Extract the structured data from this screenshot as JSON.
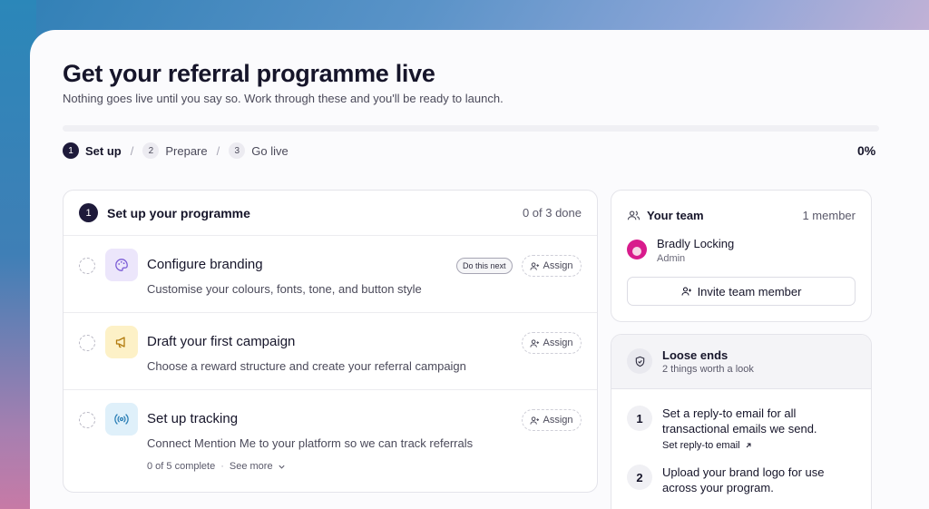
{
  "page": {
    "title": "Get your referral programme live",
    "subtitle": "Nothing goes live until you say so. Work through these and you'll be ready to launch.",
    "progress_percent": 0,
    "progress_label": "0%"
  },
  "steps": [
    {
      "num": "1",
      "label": "Set up",
      "active": true
    },
    {
      "num": "2",
      "label": "Prepare",
      "active": false
    },
    {
      "num": "3",
      "label": "Go live",
      "active": false
    }
  ],
  "step_separator": "/",
  "tasks_section": {
    "num": "1",
    "title": "Set up your programme",
    "count": "0 of 3 done",
    "tasks": [
      {
        "title": "Configure branding",
        "desc": "Customise your colours, fonts, tone, and button style",
        "badge": "Do this next",
        "assign": "Assign",
        "icon": "palette-icon",
        "icon_bg": "#ece6fb",
        "icon_color": "#7b5cd6"
      },
      {
        "title": "Draft your first campaign",
        "desc": "Choose a reward structure and create your referral campaign",
        "assign": "Assign",
        "icon": "megaphone-icon",
        "icon_bg": "#fdf1c7",
        "icon_color": "#b27b0e"
      },
      {
        "title": "Set up tracking",
        "desc": "Connect Mention Me to your platform so we can track referrals",
        "assign": "Assign",
        "icon": "broadcast-icon",
        "icon_bg": "#dff0fa",
        "icon_color": "#2b7fb6",
        "meta": "0 of 5 complete",
        "meta_sep": "·",
        "see_more": "See more"
      }
    ]
  },
  "team": {
    "title": "Your team",
    "count": "1 member",
    "member": {
      "name": "Bradly Locking",
      "role": "Admin",
      "avatar_color": "#d81b8c"
    },
    "invite_label": "Invite team member"
  },
  "loose_ends": {
    "title": "Loose ends",
    "subtitle": "2 things worth a look",
    "items": [
      {
        "num": "1",
        "text": "Set a reply-to email for all transactional emails we send.",
        "link": "Set reply-to email"
      },
      {
        "num": "2",
        "text": "Upload your brand logo for use across your program."
      }
    ]
  }
}
